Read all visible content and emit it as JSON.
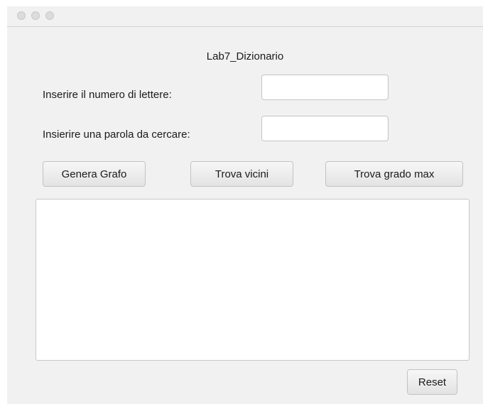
{
  "window": {
    "title": "",
    "traffic_lights": [
      "close",
      "minimize",
      "zoom"
    ]
  },
  "app": {
    "title": "Lab7_Dizionario"
  },
  "form": {
    "letters_label": "Inserire il numero di lettere:",
    "letters_value": "",
    "word_label": "Insierire una parola da cercare:",
    "word_value": ""
  },
  "buttons": {
    "genera_grafo": "Genera Grafo",
    "trova_vicini": "Trova vicini",
    "trova_grado_max": "Trova grado max",
    "reset": "Reset"
  },
  "output": {
    "text": ""
  }
}
